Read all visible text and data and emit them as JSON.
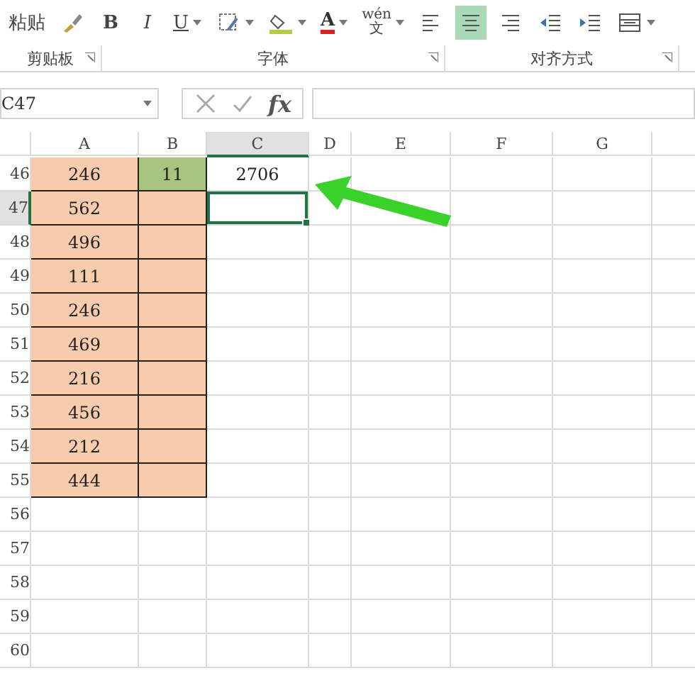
{
  "ribbon": {
    "tools": [
      {
        "kind": "paste",
        "label": "粘贴"
      },
      {
        "kind": "brush"
      },
      {
        "kind": "bold",
        "label": "B"
      },
      {
        "kind": "italic",
        "label": "I"
      },
      {
        "kind": "underline",
        "label": "U"
      },
      {
        "kind": "border"
      },
      {
        "kind": "fill"
      },
      {
        "kind": "fontcolor",
        "label": "A"
      },
      {
        "kind": "phonetic",
        "label": "wén",
        "sub": "文"
      },
      {
        "kind": "alignleft",
        "selected": false
      },
      {
        "kind": "aligncenter",
        "selected": true
      },
      {
        "kind": "alignright",
        "selected": false
      },
      {
        "kind": "outdent"
      },
      {
        "kind": "indent"
      },
      {
        "kind": "merge"
      }
    ],
    "groups": [
      {
        "label": "剪贴板"
      },
      {
        "label": "字体"
      },
      {
        "label": "对齐方式"
      }
    ]
  },
  "formula_bar": {
    "name_box": "C47",
    "fx": "fx"
  },
  "columns": [
    {
      "label": "A",
      "selected": false
    },
    {
      "label": "B",
      "selected": false
    },
    {
      "label": "C",
      "selected": true
    },
    {
      "label": "D",
      "selected": false
    },
    {
      "label": "E",
      "selected": false
    },
    {
      "label": "F",
      "selected": false
    },
    {
      "label": "G",
      "selected": false
    }
  ],
  "rows": [
    {
      "label": "46",
      "selected": false,
      "cells": [
        {
          "text": "246",
          "color": "#f8cbad"
        },
        {
          "text": "11",
          "color": "#a9c47f"
        },
        {
          "text": "2706",
          "selected": false
        }
      ]
    },
    {
      "label": "47",
      "selected": true,
      "cells": [
        {
          "text": "562",
          "color": "#f8cbad"
        },
        {
          "color": "#f8cbad"
        },
        {
          "selected": true
        }
      ]
    },
    {
      "label": "48",
      "selected": false,
      "cells": [
        {
          "text": "496",
          "color": "#f8cbad"
        },
        {
          "color": "#f8cbad"
        },
        {
          "selected": false
        }
      ]
    },
    {
      "label": "49",
      "selected": false,
      "cells": [
        {
          "text": "111",
          "color": "#f8cbad"
        },
        {
          "color": "#f8cbad"
        },
        {
          "selected": false
        }
      ]
    },
    {
      "label": "50",
      "selected": false,
      "cells": [
        {
          "text": "246",
          "color": "#f8cbad"
        },
        {
          "color": "#f8cbad"
        },
        {
          "selected": false
        }
      ]
    },
    {
      "label": "51",
      "selected": false,
      "cells": [
        {
          "text": "469",
          "color": "#f8cbad"
        },
        {
          "color": "#f8cbad"
        },
        {
          "selected": false
        }
      ]
    },
    {
      "label": "52",
      "selected": false,
      "cells": [
        {
          "text": "216",
          "color": "#f8cbad"
        },
        {
          "color": "#f8cbad"
        },
        {
          "selected": false
        }
      ]
    },
    {
      "label": "53",
      "selected": false,
      "cells": [
        {
          "text": "456",
          "color": "#f8cbad"
        },
        {
          "color": "#f8cbad"
        },
        {
          "selected": false
        }
      ]
    },
    {
      "label": "54",
      "selected": false,
      "cells": [
        {
          "text": "212",
          "color": "#f8cbad"
        },
        {
          "color": "#f8cbad"
        },
        {
          "selected": false
        }
      ]
    },
    {
      "label": "55",
      "selected": false,
      "cells": [
        {
          "text": "444",
          "color": "#f8cbad"
        },
        {
          "color": "#f8cbad"
        },
        {
          "selected": false
        }
      ]
    },
    {
      "label": "56",
      "selected": false,
      "cells": []
    },
    {
      "label": "57",
      "selected": false,
      "cells": []
    },
    {
      "label": "58",
      "selected": false,
      "cells": []
    },
    {
      "label": "59",
      "selected": false,
      "cells": []
    },
    {
      "label": "60",
      "selected": false,
      "cells": []
    }
  ]
}
